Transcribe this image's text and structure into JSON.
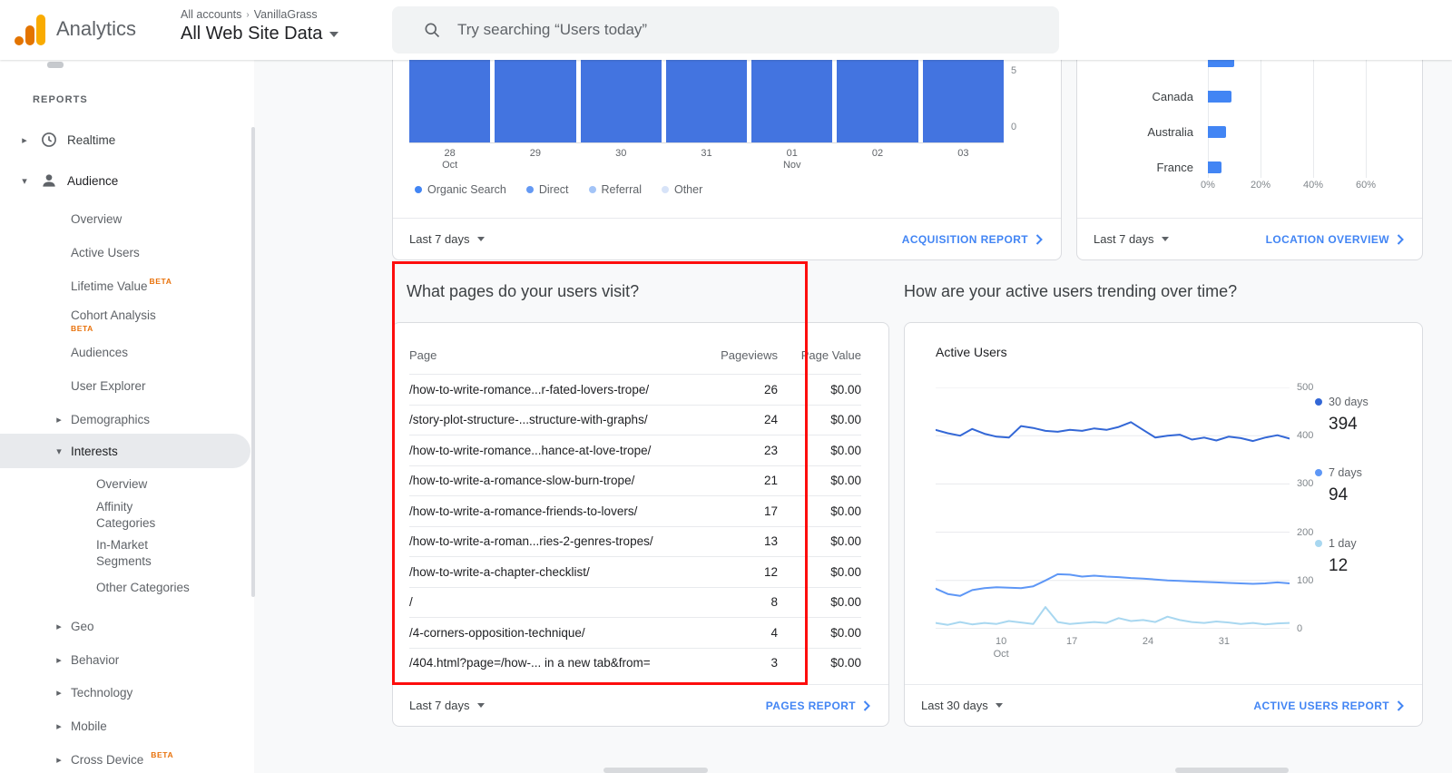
{
  "header": {
    "app_name": "Analytics",
    "breadcrumb": {
      "root": "All accounts",
      "separator": "›",
      "account": "VanillaGrass"
    },
    "property_selector": "All Web Site Data",
    "search": {
      "placeholder": "Try searching “Users today”"
    }
  },
  "sidebar": {
    "section_label": "REPORTS",
    "beta_label": "BETA",
    "realtime": "Realtime",
    "audience": "Audience",
    "audience_items": {
      "overview": "Overview",
      "active_users": "Active Users",
      "lifetime_value": "Lifetime Value",
      "cohort_analysis": "Cohort Analysis",
      "audiences": "Audiences",
      "user_explorer": "User Explorer",
      "demographics": "Demographics",
      "interests": "Interests",
      "geo": "Geo",
      "behavior": "Behavior",
      "technology": "Technology",
      "mobile": "Mobile",
      "cross_device": "Cross Device"
    },
    "interests_items": {
      "overview": "Overview",
      "affinity_categories": "Affinity Categories",
      "in_market_segments": "In-Market Segments",
      "other_categories": "Other Categories"
    }
  },
  "cards": {
    "acquisition": {
      "date_range": "Last 7 days",
      "report_link": "ACQUISITION REPORT"
    },
    "location": {
      "date_range": "Last 7 days",
      "report_link": "LOCATION OVERVIEW"
    },
    "pages": {
      "question": "What pages do your users visit?",
      "columns": [
        "Page",
        "Pageviews",
        "Page Value"
      ],
      "rows": [
        {
          "page": "/how-to-write-romance...r-fated-lovers-trope/",
          "pageviews": "26",
          "page_value": "$0.00"
        },
        {
          "page": "/story-plot-structure-...structure-with-graphs/",
          "pageviews": "24",
          "page_value": "$0.00"
        },
        {
          "page": "/how-to-write-romance...hance-at-love-trope/",
          "pageviews": "23",
          "page_value": "$0.00"
        },
        {
          "page": "/how-to-write-a-romance-slow-burn-trope/",
          "pageviews": "21",
          "page_value": "$0.00"
        },
        {
          "page": "/how-to-write-a-romance-friends-to-lovers/",
          "pageviews": "17",
          "page_value": "$0.00"
        },
        {
          "page": "/how-to-write-a-roman...ries-2-genres-tropes/",
          "pageviews": "13",
          "page_value": "$0.00"
        },
        {
          "page": "/how-to-write-a-chapter-checklist/",
          "pageviews": "12",
          "page_value": "$0.00"
        },
        {
          "page": "/",
          "pageviews": "8",
          "page_value": "$0.00"
        },
        {
          "page": "/4-corners-opposition-technique/",
          "pageviews": "4",
          "page_value": "$0.00"
        },
        {
          "page": "/404.html?page=/how-... in a new tab&from=",
          "pageviews": "3",
          "page_value": "$0.00"
        }
      ],
      "date_range": "Last 7 days",
      "report_link": "PAGES REPORT"
    },
    "active_users": {
      "question": "How are your active users trending over time?",
      "chart_title": "Active Users",
      "legend": [
        {
          "label": "30 days",
          "value": "394",
          "color": "#3367d6"
        },
        {
          "label": "7 days",
          "value": "94",
          "color": "#5e97f6"
        },
        {
          "label": "1 day",
          "value": "12",
          "color": "#a8d7f0"
        }
      ],
      "date_range": "Last 30 days",
      "report_link": "ACTIVE USERS REPORT"
    }
  },
  "chart_data": [
    {
      "id": "acquisition_sessions",
      "type": "bar",
      "categories": [
        "28 Oct",
        "29",
        "30",
        "31",
        "01 Nov",
        "02",
        "03"
      ],
      "values": [
        5,
        5,
        5,
        5,
        5,
        5,
        5
      ],
      "tick_labels": [
        "28\nOct",
        "29",
        "30",
        "31",
        "01\nNov",
        "02",
        "03"
      ],
      "yticks": [
        "5",
        "0"
      ],
      "ylim": [
        0,
        5
      ],
      "bar_color": "#4374e0",
      "legend": [
        "Organic Search",
        "Direct",
        "Referral",
        "Other"
      ],
      "legend_colors": [
        "#4285f4",
        "#6499f3",
        "#a3c4f7",
        "#d7e3f8"
      ],
      "note": "bars clipped at top of visible scroll area"
    },
    {
      "id": "location_users",
      "type": "bar",
      "orientation": "horizontal",
      "categories": [
        "",
        "Canada",
        "Australia",
        "France"
      ],
      "values": [
        10,
        9,
        7,
        5
      ],
      "xticks": [
        "0%",
        "20%",
        "40%",
        "60%"
      ],
      "xlim": [
        0,
        64
      ],
      "bar_color": "#4285f4",
      "note": "top row label clipped by scroll"
    },
    {
      "id": "active_users_trend",
      "type": "line",
      "title": "Active Users",
      "xticks": [
        "10\nOct",
        "17",
        "24",
        "31"
      ],
      "xtick_pos": [
        0.185,
        0.385,
        0.6,
        0.815
      ],
      "yticks": [
        500,
        400,
        300,
        200,
        100,
        0
      ],
      "ylim": [
        0,
        500
      ],
      "grid": true,
      "legend_position": "right",
      "series": [
        {
          "name": "30 days",
          "color": "#3367d6",
          "current": 394,
          "values": [
            412,
            405,
            400,
            414,
            404,
            398,
            396,
            420,
            416,
            410,
            408,
            412,
            410,
            415,
            412,
            418,
            428,
            412,
            396,
            400,
            402,
            392,
            396,
            390,
            398,
            395,
            389,
            396,
            401,
            394
          ]
        },
        {
          "name": "7 days",
          "color": "#5e97f6",
          "current": 94,
          "values": [
            83,
            72,
            68,
            80,
            84,
            86,
            85,
            84,
            88,
            100,
            113,
            112,
            108,
            110,
            108,
            107,
            105,
            104,
            102,
            100,
            99,
            98,
            97,
            96,
            95,
            94,
            93,
            94,
            96,
            94
          ]
        },
        {
          "name": "1 day",
          "color": "#a8d7f0",
          "current": 12,
          "values": [
            12,
            8,
            14,
            9,
            12,
            10,
            16,
            13,
            10,
            45,
            14,
            10,
            12,
            14,
            12,
            22,
            16,
            18,
            14,
            25,
            18,
            14,
            12,
            15,
            13,
            10,
            12,
            9,
            11,
            12
          ]
        }
      ]
    }
  ]
}
